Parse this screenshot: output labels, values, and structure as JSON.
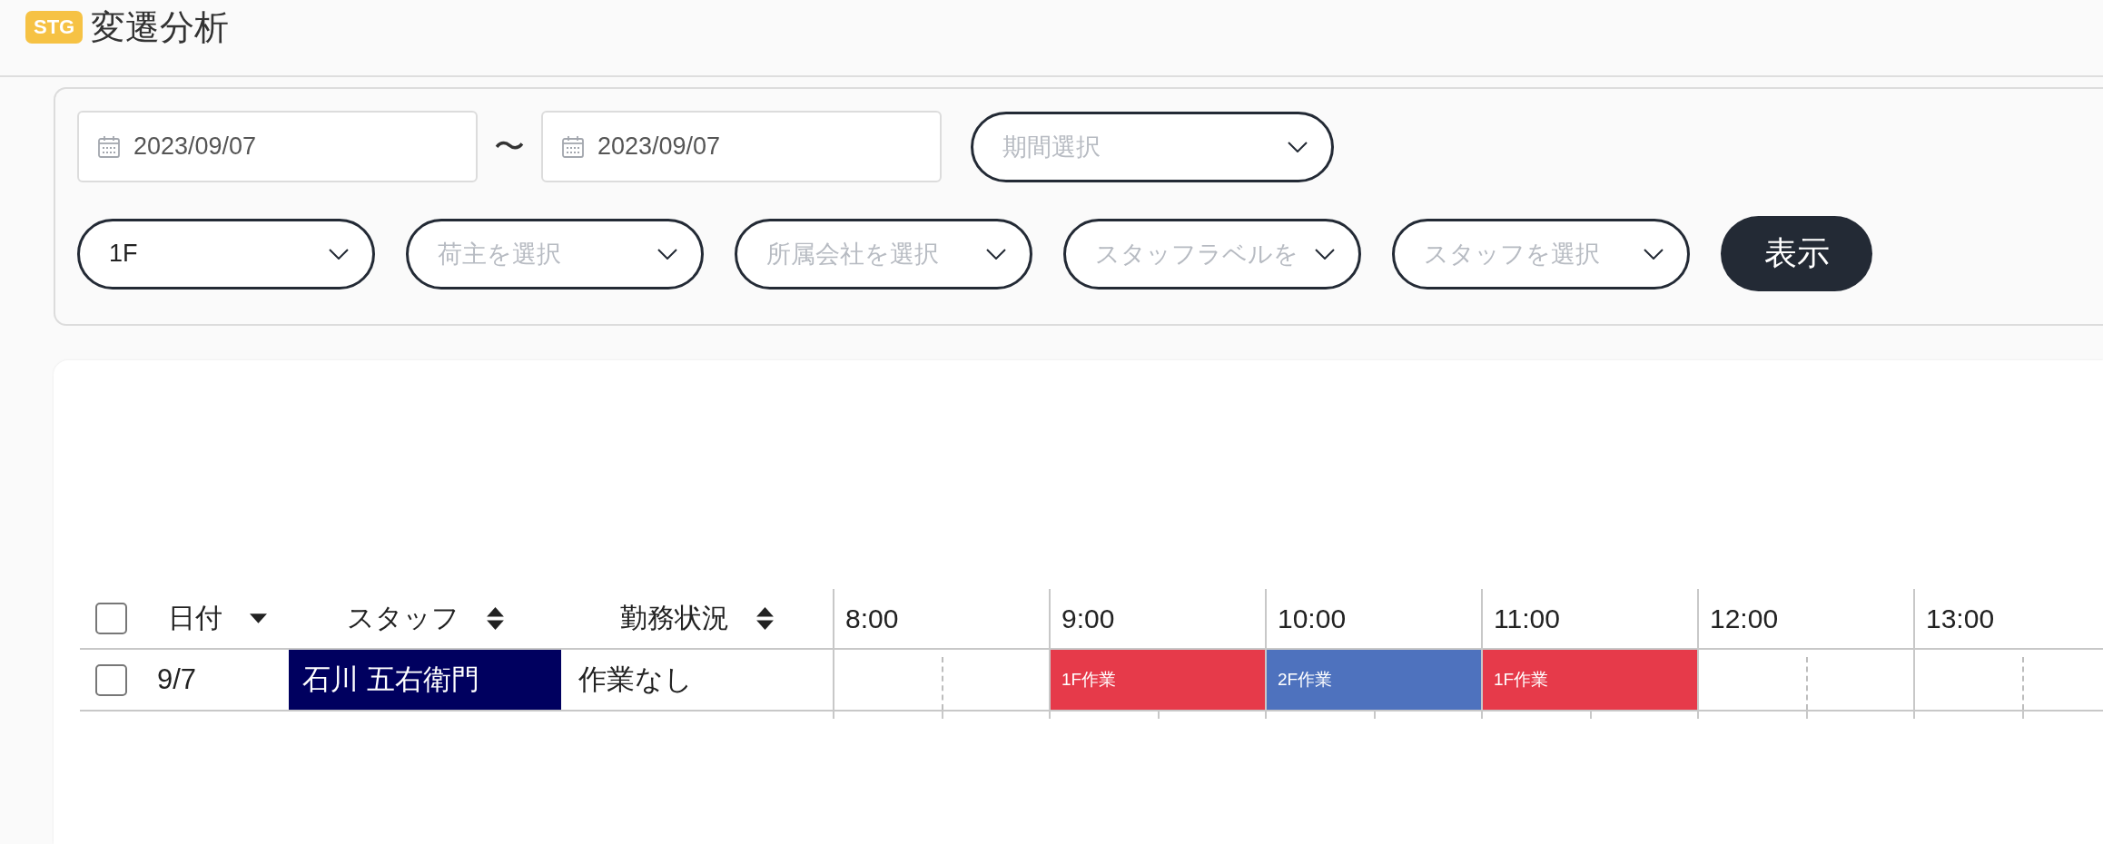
{
  "header": {
    "badge": "STG",
    "title": "変遷分析"
  },
  "filters": {
    "date_from": "2023/09/07",
    "separator": "〜",
    "date_to": "2023/09/07",
    "period_select": {
      "placeholder": "期間選択"
    },
    "selects": [
      {
        "value": "1F"
      },
      {
        "placeholder": "荷主を選択"
      },
      {
        "placeholder": "所属会社を選択"
      },
      {
        "placeholder": "スタッフラベルを"
      },
      {
        "placeholder": "スタッフを選択"
      }
    ],
    "submit_button": "表示"
  },
  "table": {
    "select_all": {
      "checked": false
    },
    "columns": [
      {
        "label": "日付",
        "sorted": true
      },
      {
        "label": "スタッフ",
        "sorted": false
      },
      {
        "label": "勤務状況",
        "sorted": false
      }
    ],
    "hours": [
      "8:00",
      "9:00",
      "10:00",
      "11:00",
      "12:00",
      "13:00"
    ],
    "rows": [
      {
        "checked": false,
        "date": "9/7",
        "staff": {
          "name": "石川 五右衛門",
          "color": "#00005f"
        },
        "status": "作業なし",
        "slots": [
          {
            "kind": "empty"
          },
          {
            "kind": "task",
            "label": "1F作業",
            "color": "#e63a4a"
          },
          {
            "kind": "task",
            "label": "2F作業",
            "color": "#4e72be"
          },
          {
            "kind": "task",
            "label": "1F作業",
            "color": "#e63a4a"
          },
          {
            "kind": "empty"
          },
          {
            "kind": "empty"
          }
        ]
      }
    ]
  }
}
